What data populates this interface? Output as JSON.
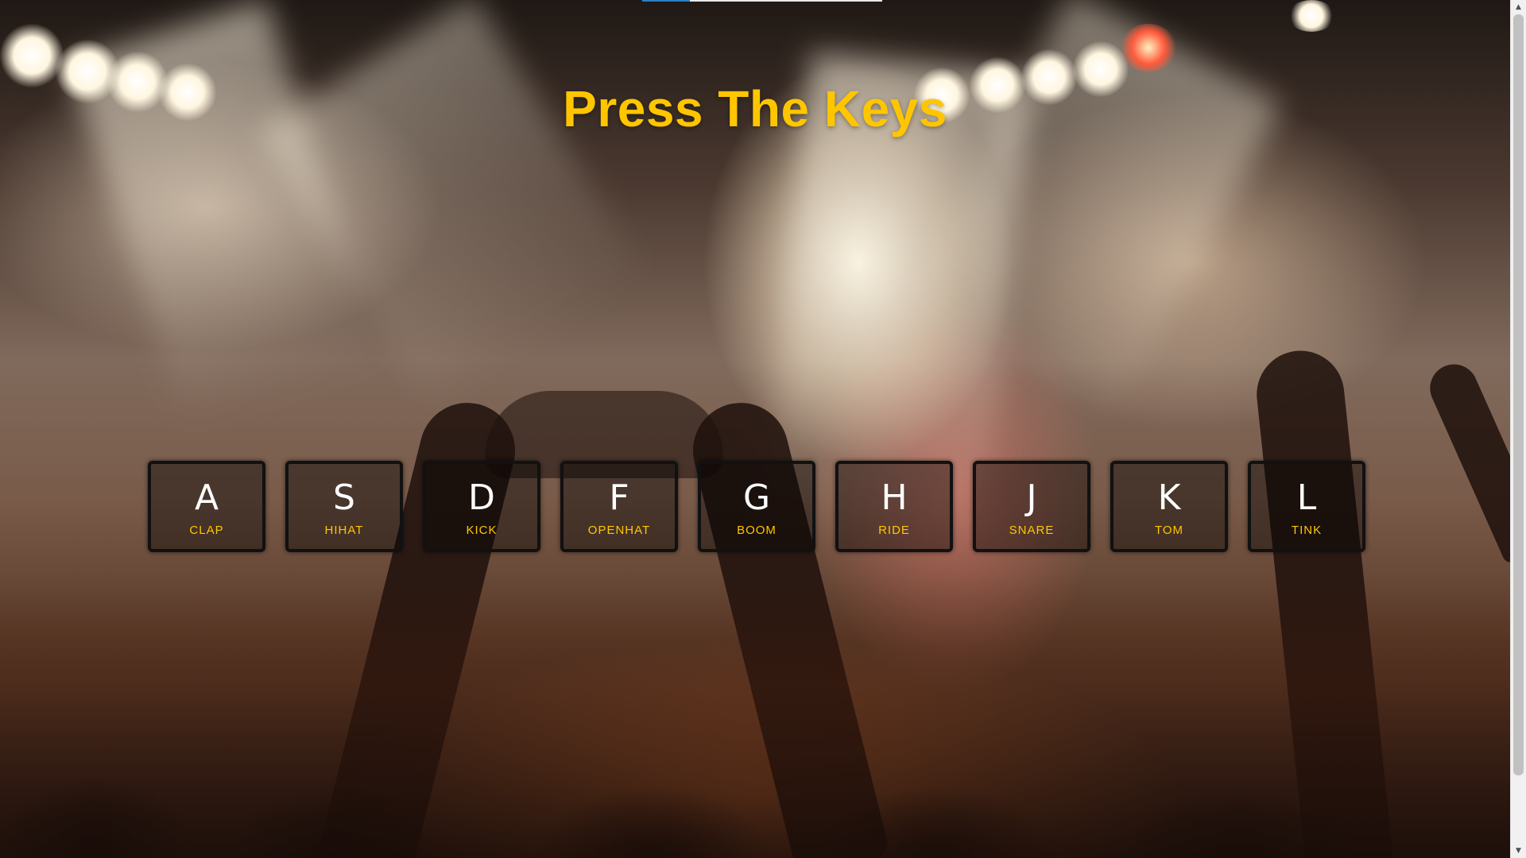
{
  "page": {
    "title": "Press The Keys"
  },
  "keys": [
    {
      "letter": "A",
      "sound": "CLAP"
    },
    {
      "letter": "S",
      "sound": "HIHAT"
    },
    {
      "letter": "D",
      "sound": "KICK"
    },
    {
      "letter": "F",
      "sound": "OPENHAT"
    },
    {
      "letter": "G",
      "sound": "BOOM"
    },
    {
      "letter": "H",
      "sound": "RIDE"
    },
    {
      "letter": "J",
      "sound": "SNARE"
    },
    {
      "letter": "K",
      "sound": "TOM"
    },
    {
      "letter": "L",
      "sound": "TINK"
    }
  ],
  "colors": {
    "title": "#ffc600",
    "sound_label": "#ffc600",
    "key_letter": "#ffffff",
    "key_border": "#111111"
  },
  "scrollbar": {
    "up_icon": "triangle-up",
    "down_icon": "triangle-down"
  }
}
